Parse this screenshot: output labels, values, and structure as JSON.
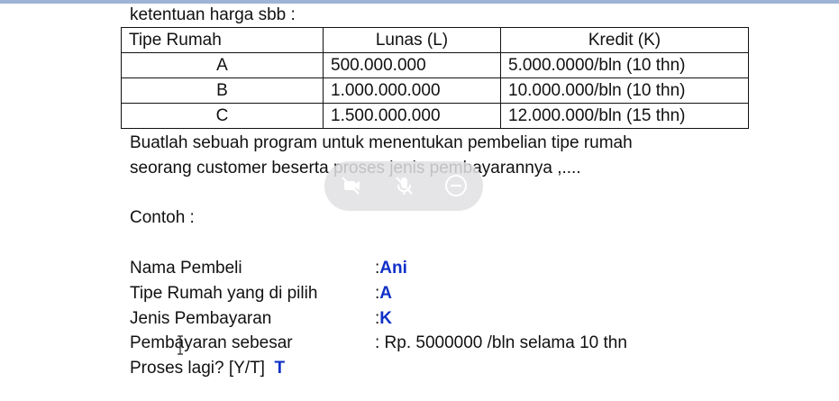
{
  "intro_text": "ketentuan harga sbb :",
  "table": {
    "headers": [
      "Tipe Rumah",
      "Lunas (L)",
      "Kredit (K)"
    ],
    "rows": [
      [
        "A",
        "500.000.000",
        "5.000.0000/bln (10 thn)"
      ],
      [
        "B",
        "1.000.000.000",
        "10.000.000/bln  (10 thn)"
      ],
      [
        "C",
        "1.500.000.000",
        "12.000.000/bln (15 thn)"
      ]
    ]
  },
  "paragraph": {
    "line1": "Buatlah sebuah program untuk menentukan pembelian tipe rumah",
    "line2": "seorang customer  beserta proses jenis pembayarannya ,...."
  },
  "example_title": "Contoh :",
  "example": [
    {
      "label": "Nama Pembeli",
      "colon": ":",
      "value": "Ani"
    },
    {
      "label": "Tipe Rumah yang di pilih",
      "colon": ":",
      "value": "A"
    },
    {
      "label": "Jenis Pembayaran",
      "colon": ":",
      "value": "K"
    },
    {
      "label": "Pembayaran  sebesar",
      "colon": ": Rp. 5000000 /bln selama 10 thn",
      "value": ""
    }
  ],
  "prompt": {
    "label": "Proses lagi? [Y/T]",
    "value": "T"
  },
  "overlay_icons": [
    "video-off-icon",
    "mic-off-icon",
    "minus-circle-icon"
  ],
  "colors": {
    "input_value": "#1030c8",
    "top_bar": "#9db4d6"
  }
}
